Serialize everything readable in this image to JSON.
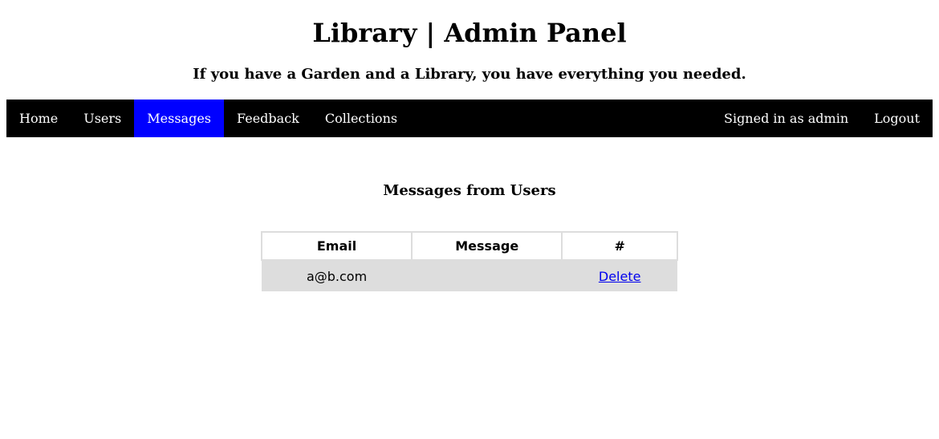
{
  "header": {
    "title": "Library | Admin Panel",
    "tagline": "If you have a Garden and a Library, you have everything you needed."
  },
  "nav": {
    "left_items": [
      {
        "label": "Home",
        "active": false
      },
      {
        "label": "Users",
        "active": false
      },
      {
        "label": "Messages",
        "active": true
      },
      {
        "label": "Feedback",
        "active": false
      },
      {
        "label": "Collections",
        "active": false
      }
    ],
    "signed_in_label": "Signed in as admin",
    "logout_label": "Logout",
    "active_color": "#0000ff"
  },
  "main": {
    "section_title": "Messages from Users",
    "table": {
      "headers": [
        "Email",
        "Message",
        "#"
      ],
      "rows": [
        {
          "email": "a@b.com",
          "message": "",
          "action": "Delete"
        }
      ]
    }
  }
}
